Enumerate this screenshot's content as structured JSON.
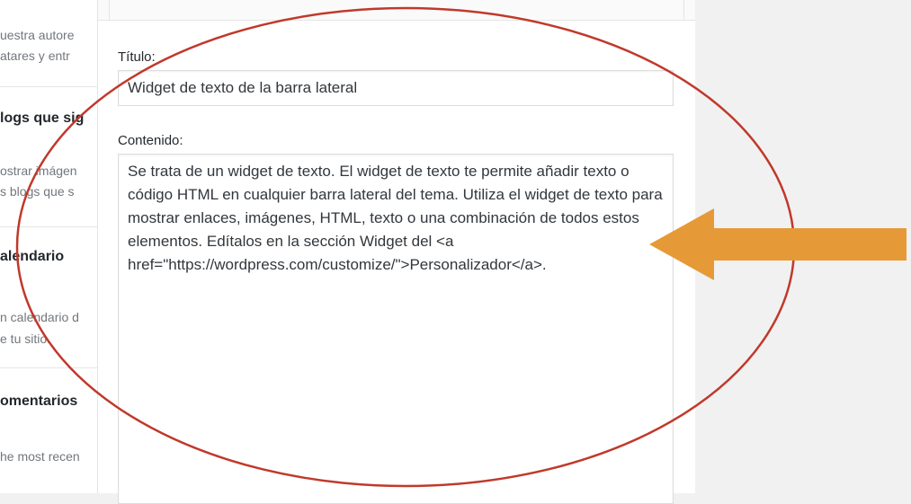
{
  "sidebar_widgets": [
    {
      "desc_lines": [
        "uestra autore",
        "atares y entr"
      ]
    },
    {
      "title": "logs que sig",
      "desc_lines": [
        "ostrar imágen",
        "s blogs que s"
      ]
    },
    {
      "title": "alendario",
      "desc_lines": [
        "n calendario d",
        "e tu sitio."
      ]
    },
    {
      "title": "omentarios",
      "desc_lines": [
        "he most recen"
      ]
    }
  ],
  "widget": {
    "title_label": "Título:",
    "title_value": "Widget de texto de la barra lateral",
    "content_label": "Contenido:",
    "content_value": "Se trata de un widget de texto. El widget de texto te permite añadir texto o código HTML en cualquier barra lateral del tema. Utiliza el widget de texto para mostrar enlaces, imágenes, HTML, texto o una combinación de todos estos elementos. Edítalos en la sección Widget del <a href=\"https://wordpress.com/customize/\">Personalizador</a>."
  },
  "annotations": {
    "circle_color": "#c0392b",
    "arrow_color": "#e59a37"
  }
}
